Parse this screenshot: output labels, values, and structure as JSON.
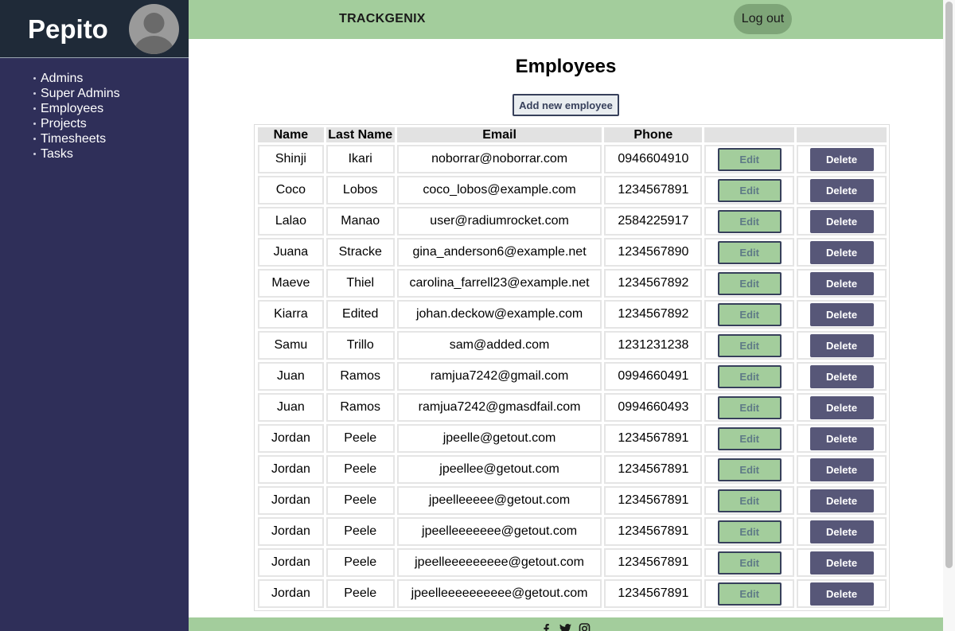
{
  "sidebar": {
    "user_name": "Pepito",
    "items": [
      {
        "label": "Admins"
      },
      {
        "label": "Super Admins"
      },
      {
        "label": "Employees"
      },
      {
        "label": "Projects"
      },
      {
        "label": "Timesheets"
      },
      {
        "label": "Tasks"
      }
    ]
  },
  "header": {
    "title": "TRACKGENIX",
    "logout_label": "Log out"
  },
  "main": {
    "title": "Employees",
    "add_label": "Add new employee"
  },
  "table": {
    "headers": [
      "Name",
      "Last Name",
      "Email",
      "Phone",
      "",
      ""
    ],
    "edit_label": "Edit",
    "delete_label": "Delete",
    "rows": [
      {
        "name": "Shinji",
        "last_name": "Ikari",
        "email": "noborrar@noborrar.com",
        "phone": "0946604910"
      },
      {
        "name": "Coco",
        "last_name": "Lobos",
        "email": "coco_lobos@example.com",
        "phone": "1234567891"
      },
      {
        "name": "Lalao",
        "last_name": "Manao",
        "email": "user@radiumrocket.com",
        "phone": "2584225917"
      },
      {
        "name": "Juana",
        "last_name": "Stracke",
        "email": "gina_anderson6@example.net",
        "phone": "1234567890"
      },
      {
        "name": "Maeve",
        "last_name": "Thiel",
        "email": "carolina_farrell23@example.net",
        "phone": "1234567892"
      },
      {
        "name": "Kiarra",
        "last_name": "Edited",
        "email": "johan.deckow@example.com",
        "phone": "1234567892"
      },
      {
        "name": "Samu",
        "last_name": "Trillo",
        "email": "sam@added.com",
        "phone": "1231231238"
      },
      {
        "name": "Juan",
        "last_name": "Ramos",
        "email": "ramjua7242@gmail.com",
        "phone": "0994660491"
      },
      {
        "name": "Juan",
        "last_name": "Ramos",
        "email": "ramjua7242@gmasdfail.com",
        "phone": "0994660493"
      },
      {
        "name": "Jordan",
        "last_name": "Peele",
        "email": "jpeelle@getout.com",
        "phone": "1234567891"
      },
      {
        "name": "Jordan",
        "last_name": "Peele",
        "email": "jpeellee@getout.com",
        "phone": "1234567891"
      },
      {
        "name": "Jordan",
        "last_name": "Peele",
        "email": "jpeelleeeee@getout.com",
        "phone": "1234567891"
      },
      {
        "name": "Jordan",
        "last_name": "Peele",
        "email": "jpeelleeeeeee@getout.com",
        "phone": "1234567891"
      },
      {
        "name": "Jordan",
        "last_name": "Peele",
        "email": "jpeelleeeeeeeee@getout.com",
        "phone": "1234567891"
      },
      {
        "name": "Jordan",
        "last_name": "Peele",
        "email": "jpeelleeeeeeeeee@getout.com",
        "phone": "1234567891"
      }
    ]
  },
  "footer": {
    "icons": [
      "facebook-icon",
      "twitter-icon",
      "instagram-icon"
    ]
  },
  "colors": {
    "sidebar_bg": "#2f2f59",
    "brand_bg": "#1f2a38",
    "header_bg": "#a3cd9c",
    "logout_bg": "#7ea578",
    "delete_bg": "#575778",
    "button_border": "#37405b"
  }
}
